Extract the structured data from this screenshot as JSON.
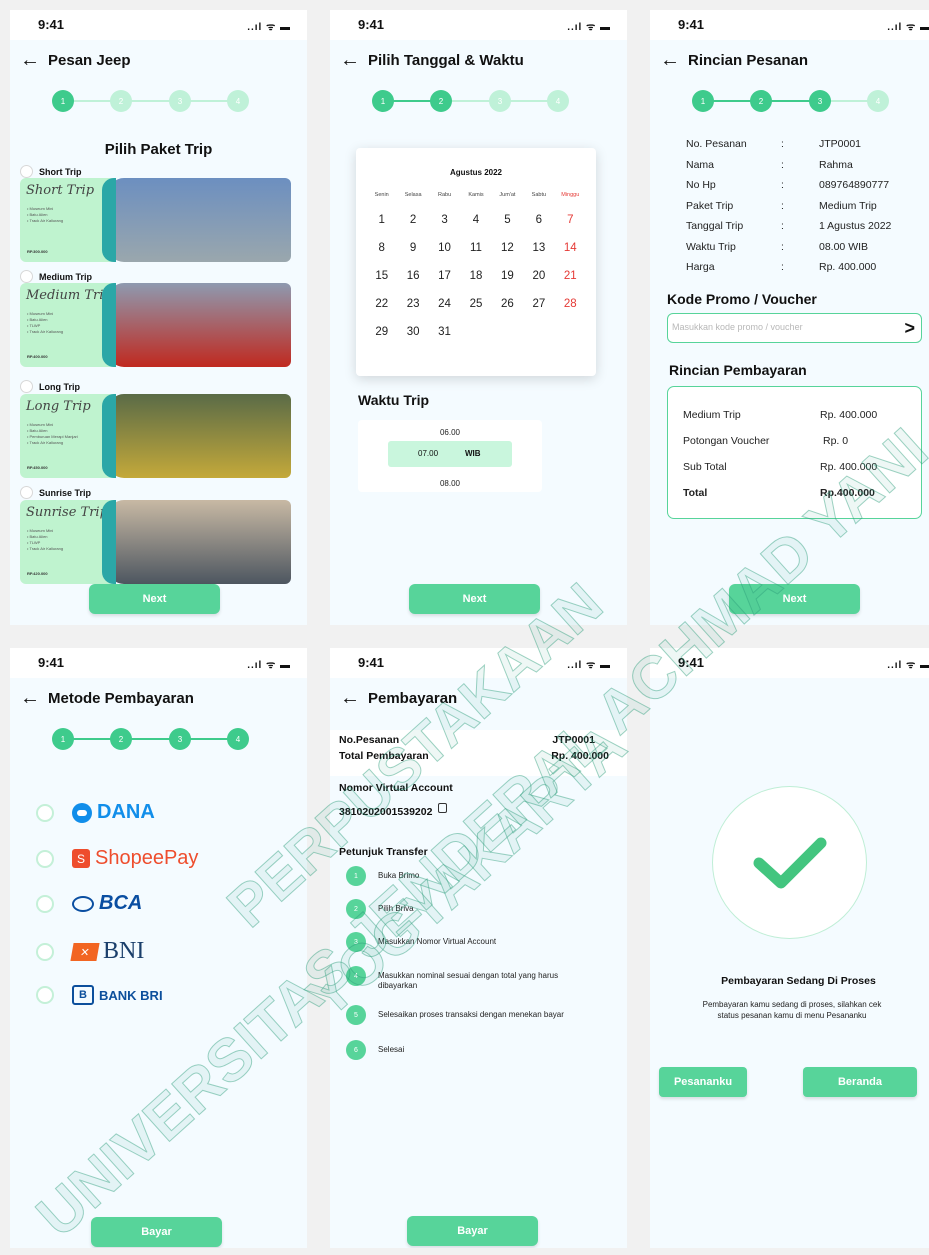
{
  "status": {
    "time": "9:41",
    "signal_text": "..ıl ᯤ ▬"
  },
  "steps": [
    "1",
    "2",
    "3",
    "4"
  ],
  "screen1": {
    "title": "Pesan Jeep",
    "section_title": "Pilih Paket Trip",
    "packages": [
      {
        "label": "Short Trip",
        "script": "Short Trip",
        "items": [
          "Museum Mini",
          "Batu Alien",
          "Track Air Kaliurang"
        ],
        "price": "RP.300.000",
        "colors": [
          "#6c8fc0",
          "#9aa7ad"
        ]
      },
      {
        "label": "Medium Trip",
        "script": "Medium Trip",
        "items": [
          "Museum Mini",
          "Batu Alien",
          "TLWP",
          "Track Air Kaliurang"
        ],
        "price": "RP.400.000",
        "colors": [
          "#8e9ab0",
          "#c0291f"
        ]
      },
      {
        "label": "Long Trip",
        "script": "Long Trip",
        "items": [
          "Museum Mini",
          "Batu Alien",
          "Pemburuan Merapi Manjari",
          "Track Air Kaliurang"
        ],
        "price": "RP.450.000",
        "colors": [
          "#5a6b47",
          "#c4a93a"
        ]
      },
      {
        "label": "Sunrise Trip",
        "script": "Sunrise Trip",
        "items": [
          "Museum Mini",
          "Batu Alien",
          "TLWP",
          "Track Air Kaliurang"
        ],
        "price": "RP.420.000",
        "colors": [
          "#c8b9a4",
          "#4d5660"
        ]
      }
    ],
    "next": "Next"
  },
  "screen2": {
    "title": "Pilih Tanggal & Waktu",
    "month": "Agustus 2022",
    "weekdays": [
      "Senin",
      "Selasa",
      "Rabu",
      "Kamis",
      "Jum'at",
      "Sabtu",
      "Minggu"
    ],
    "weeks": [
      [
        "1",
        "2",
        "3",
        "4",
        "5",
        "6",
        "7"
      ],
      [
        "8",
        "9",
        "10",
        "11",
        "12",
        "13",
        "14"
      ],
      [
        "15",
        "16",
        "17",
        "18",
        "19",
        "20",
        "21"
      ],
      [
        "22",
        "23",
        "24",
        "25",
        "26",
        "27",
        "28"
      ],
      [
        "29",
        "30",
        "31"
      ]
    ],
    "time_title": "Waktu Trip",
    "times": [
      "06.00",
      "07.00",
      "08.00"
    ],
    "wib": "WIB",
    "next": "Next"
  },
  "screen3": {
    "title": "Rincian Pesanan",
    "rows": [
      {
        "k": "No. Pesanan",
        "v": "JTP0001"
      },
      {
        "k": "Nama",
        "v": "Rahma"
      },
      {
        "k": "No Hp",
        "v": "089764890777"
      },
      {
        "k": "Paket Trip",
        "v": "Medium Trip"
      },
      {
        "k": "Tanggal Trip",
        "v": "1 Agustus 2022"
      },
      {
        "k": "Waktu Trip",
        "v": "08.00 WIB"
      },
      {
        "k": "Harga",
        "v": "Rp. 400.000"
      }
    ],
    "separator": ":",
    "promo_title": "Kode Promo / Voucher",
    "promo_placeholder": "Masukkan kode promo / voucher",
    "pay_title": "Rincian Pembayaran",
    "pay_rows": [
      {
        "k": "Medium Trip",
        "v": "Rp. 400.000"
      },
      {
        "k": "Potongan Voucher",
        "v": "Rp. 0"
      },
      {
        "k": "Sub Total",
        "v": "Rp. 400.000"
      },
      {
        "k": "Total",
        "v": "Rp.400.000"
      }
    ],
    "next": "Next"
  },
  "screen4": {
    "title": "Metode Pembayaran",
    "methods": [
      "DANA",
      "ShopeePay",
      "BCA",
      "BNI",
      "BANK BRI"
    ],
    "method_colors": [
      "#118eea",
      "#ee4d2d",
      "#0a4ea1",
      "#1b3f6b",
      "#0c4f9c"
    ],
    "bayar": "Bayar"
  },
  "screen5": {
    "title": "Pembayaran",
    "order_label": "No.Pesanan",
    "order_value": "JTP0001",
    "total_label": "Total Pembayaran",
    "total_value": "Rp. 400.000",
    "va_label": "Nomor Virtual Account",
    "va_number": "3810202001539202",
    "guide_title": "Petunjuk Transfer",
    "guide": [
      {
        "n": "1",
        "t": "Buka Brimo"
      },
      {
        "n": "2",
        "t": "Pilih Briva"
      },
      {
        "n": "3",
        "t": "Masukkan Nomor Virtual Account"
      },
      {
        "n": "4",
        "t": "Masukkan nominal sesuai dengan total yang harus dibayarkan"
      },
      {
        "n": "5",
        "t": "Selesaikan proses transaksi dengan menekan bayar"
      },
      {
        "n": "6",
        "t": "Selesai"
      }
    ],
    "bayar": "Bayar"
  },
  "screen6": {
    "title": "Pembayaran Sedang Di Proses",
    "desc": "Pembayaran kamu sedang di proses, silahkan cek status pesanan kamu di menu Pesananku",
    "btn_left": "Pesananku",
    "btn_right": "Beranda"
  },
  "watermark": {
    "lines": [
      "UNIVERSITAS JENDERAL ACHMAD YANI",
      "PERPUSTAKAAN",
      "YOGYAKARTA"
    ],
    "color": "#2c9e7a"
  }
}
